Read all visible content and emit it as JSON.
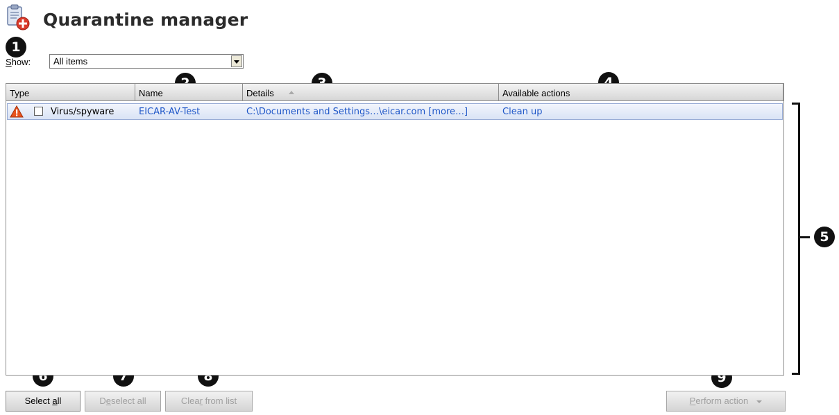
{
  "header": {
    "title": "Quarantine manager",
    "icon": "clipboard-add-icon"
  },
  "filter": {
    "label_prefix": "S",
    "label_rest": "how:",
    "selected": "All items"
  },
  "table": {
    "columns": [
      "Type",
      "Name",
      "Details",
      "Available actions"
    ],
    "sorted_column": "Details",
    "sort_direction": "ascending",
    "rows": [
      {
        "icon": "warning-icon",
        "checked": false,
        "type": "Virus/spyware",
        "name": "EICAR-AV-Test",
        "details": "C:\\Documents and Settings…\\eicar.com [more…]",
        "action": "Clean up"
      }
    ]
  },
  "buttons": {
    "select_all_pre": "Select ",
    "select_all_key": "a",
    "select_all_post": "ll",
    "deselect_all_pre": "D",
    "deselect_all_key": "e",
    "deselect_all_post": "select all",
    "clear_pre": "Clea",
    "clear_key": "r",
    "clear_post": " from list",
    "perform_key": "P",
    "perform_post": "erform action"
  },
  "callouts": [
    "1",
    "2",
    "3",
    "4",
    "5",
    "6",
    "7",
    "8",
    "9"
  ],
  "colors": {
    "link": "#1f57c8",
    "selected_row": "#d9e3f5",
    "warning": "#e8541e"
  }
}
